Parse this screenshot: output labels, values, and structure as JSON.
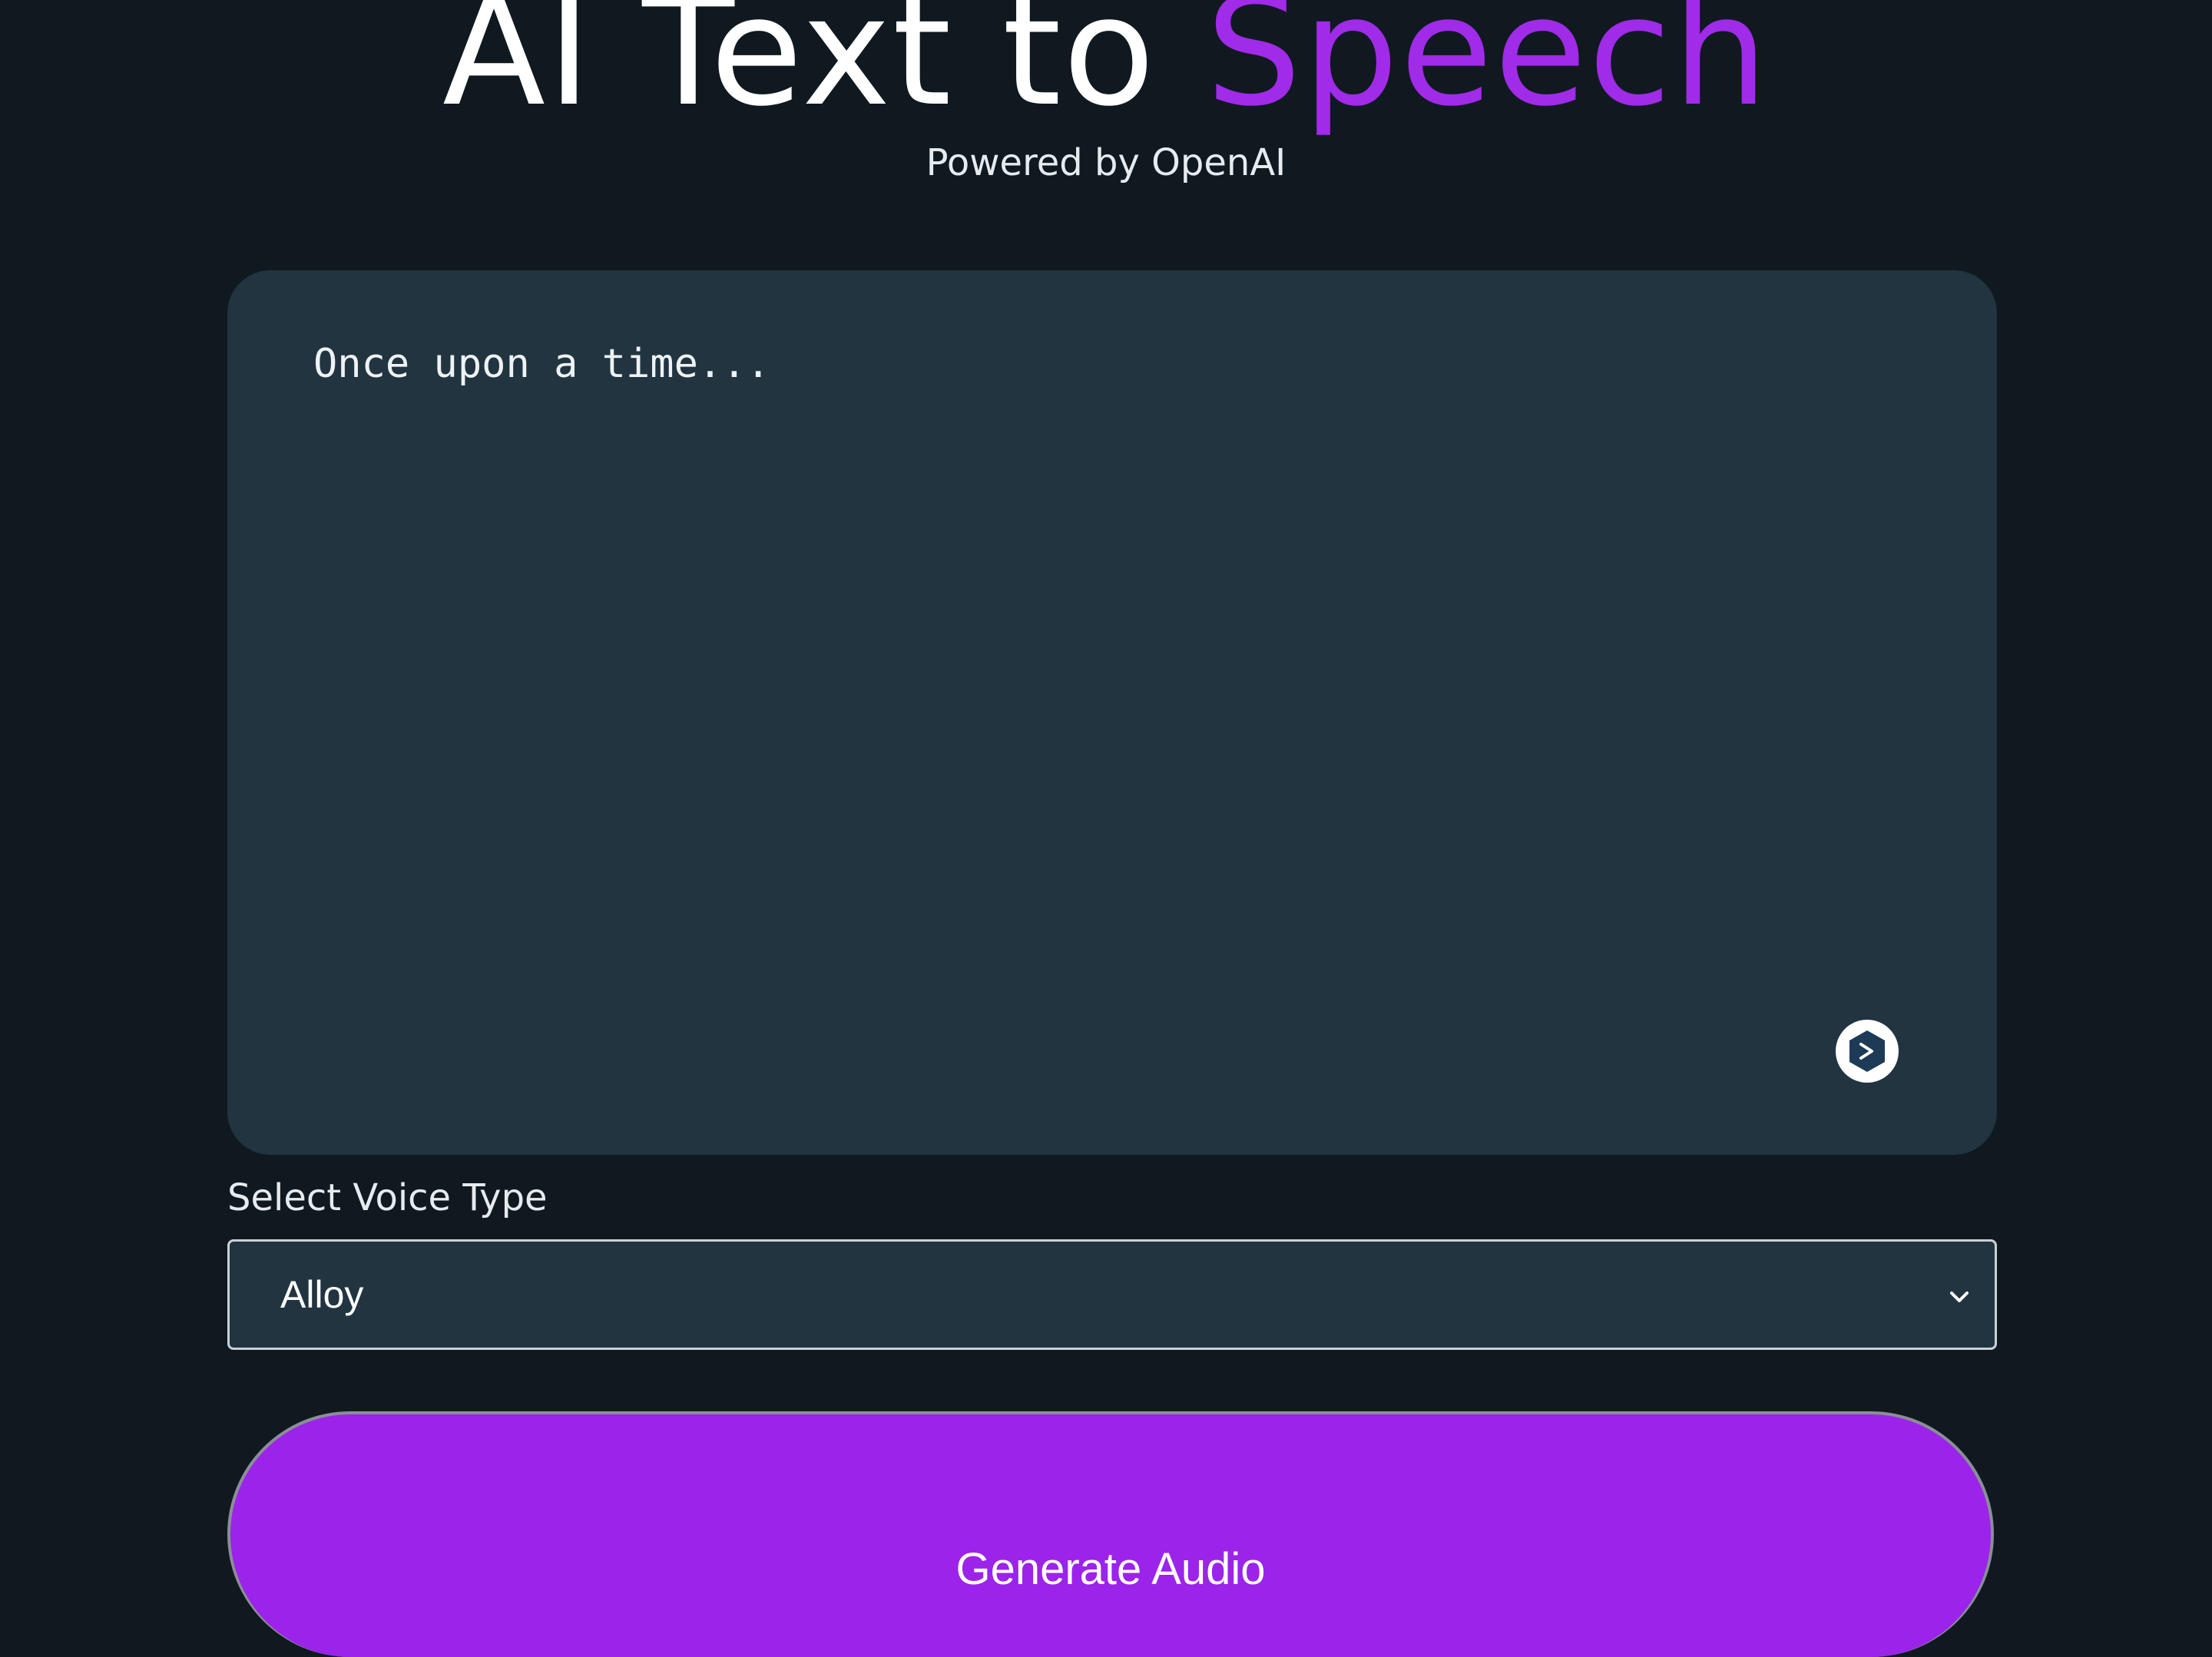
{
  "header": {
    "title_main": "AI Text to ",
    "title_accent": "Speech",
    "subtitle": "Powered by OpenAI"
  },
  "editor": {
    "placeholder": "Once upon a time...",
    "value": "",
    "helper_icon": "grammar-assistant-icon"
  },
  "voice": {
    "label": "Select Voice Type",
    "selected": "Alloy",
    "chevron_icon": "chevron-down-icon"
  },
  "actions": {
    "generate_label": "Generate Audio"
  },
  "colors": {
    "background": "#101920",
    "panel": "#213440",
    "accent": "#a02be8",
    "button": "#9b23ea",
    "text": "#eef2f5"
  }
}
